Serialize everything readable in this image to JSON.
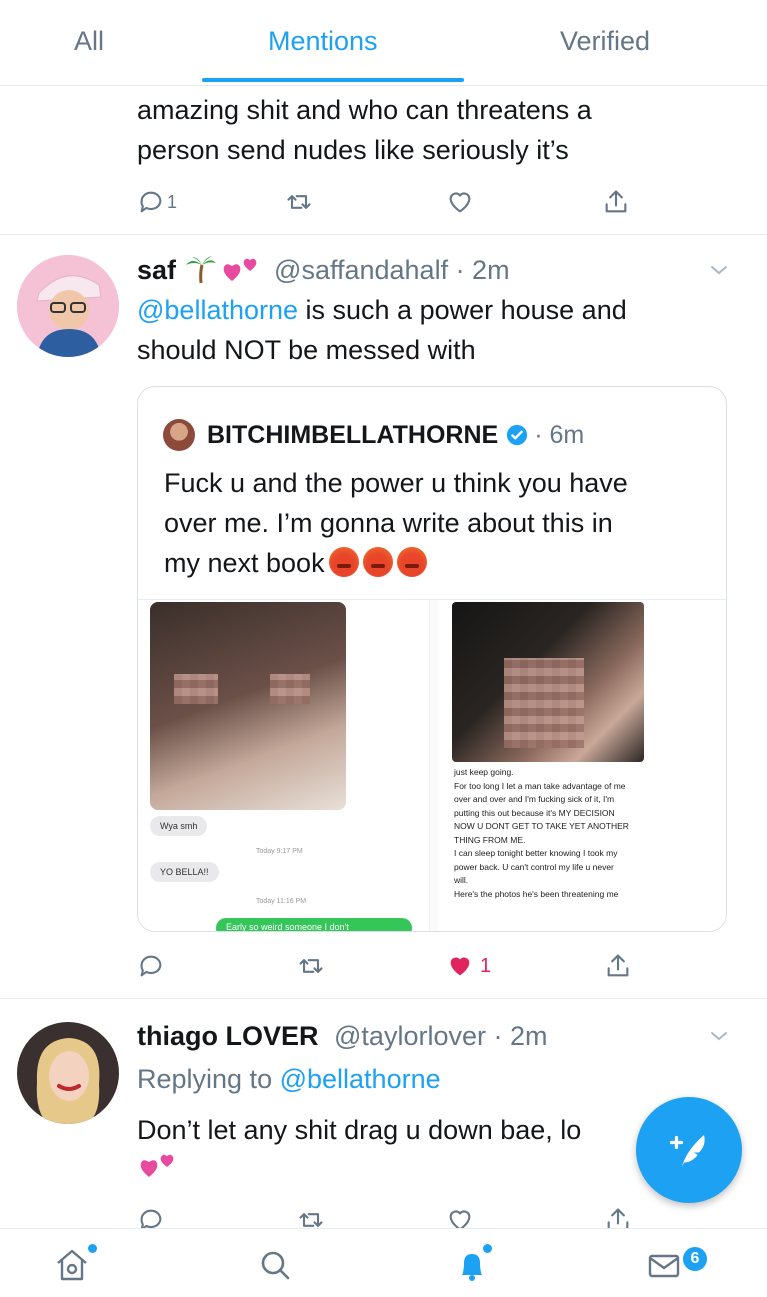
{
  "tabs": [
    "All",
    "Mentions",
    "Verified"
  ],
  "tweet1": {
    "text_line1": "amazing shit and who can threatens a",
    "text_line2": "person send nudes like seriously it’s",
    "reply_count": "1"
  },
  "tweet2": {
    "name": "saf",
    "handle_time": "@saffandahalf · 2m",
    "mention": "@bellathorne",
    "text_rest": " is such a power house and",
    "text_line2": "should NOT be messed with",
    "like_count": "1",
    "quote": {
      "name": "BITCHIMBELLATHORNE",
      "time": "· 6m",
      "line1": "Fuck u and the power u think you have",
      "line2": "over me. I’m gonna write about this in",
      "line3": "my next book",
      "left_shot": {
        "bubble1": "Wya smh",
        "time1": "Today 9:17 PM",
        "bubble2": "YO BELLA!!",
        "time2": "Today 11:16 PM",
        "green_bubble": "Early so weird someone I don't"
      },
      "right_shot": {
        "lines": [
          "just keep going.",
          "For too long I let a man take advantage of me",
          "over and over and I'm fucking sick of it, I'm",
          "putting this out because it's MY DECISION",
          "NOW U DONT GET TO TAKE YET ANOTHER",
          "THING FROM ME.",
          "I can sleep tonight better knowing I took my",
          "power back. U can't control my life u never",
          "will.",
          "Here's the photos he's been threatening me"
        ]
      }
    }
  },
  "tweet3": {
    "name": "thiago LOVER",
    "handle_time": "@taylorlover · 2m",
    "replying_prefix": "Replying to ",
    "replying_handle": "@bellathorne",
    "text": "Don’t let any shit drag u down bae, lo"
  },
  "nav": {
    "messages_badge": "6"
  },
  "colors": {
    "accent": "#1da1f2",
    "like": "#e0245e"
  }
}
